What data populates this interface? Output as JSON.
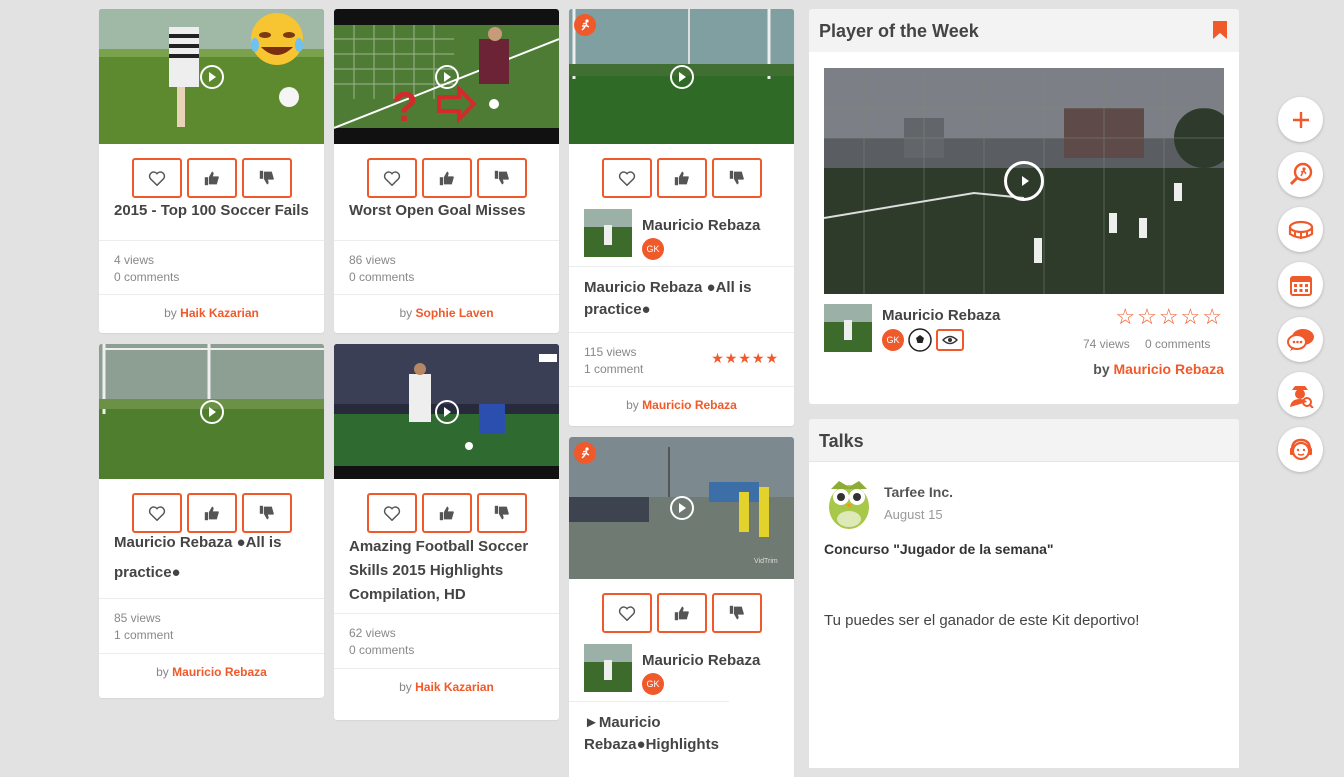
{
  "feed": {
    "col1": [
      {
        "title": "2015 - Top 100 Soccer Fails",
        "views": "4 views",
        "comments": "0 comments",
        "by_prefix": "by",
        "author": "Haik Kazarian"
      },
      {
        "title": "Mauricio Rebaza ●All is practice●",
        "views": "85 views",
        "comments": "1 comment",
        "by_prefix": "by",
        "author": "Mauricio Rebaza"
      }
    ],
    "col2": [
      {
        "title": "Worst Open Goal Misses",
        "views": "86 views",
        "comments": "0 comments",
        "by_prefix": "by",
        "author": "Sophie Laven"
      },
      {
        "title": "Amazing Football Soccer Skills 2015 Highlights Compilation, HD",
        "views": "62 views",
        "comments": "0 comments",
        "by_prefix": "by",
        "author": "Haik Kazarian"
      }
    ],
    "col3": [
      {
        "player": "Mauricio Rebaza",
        "badge": "GK",
        "title": "Mauricio Rebaza ●All is practice●",
        "views": "115 views",
        "comments": "1 comment",
        "stars": "★★★★★",
        "by_prefix": "by",
        "author": "Mauricio Rebaza"
      },
      {
        "player": "Mauricio Rebaza",
        "badge": "GK",
        "title": "►Mauricio Rebaza●Highlights"
      }
    ]
  },
  "potw": {
    "heading": "Player of the Week",
    "player": "Mauricio Rebaza",
    "badge": "GK",
    "stars": "☆☆☆☆☆",
    "views": "74 views",
    "comments": "0 comments",
    "by_prefix": "by",
    "author": "Mauricio Rebaza"
  },
  "talks": {
    "heading": "Talks",
    "company": "Tarfee Inc.",
    "date": "August 15",
    "post_title": "Concurso \"Jugador de la semana\"",
    "post_body": "Tu puedes ser el ganador de este Kit deportivo!"
  },
  "icons": {
    "actions": [
      "heart-icon",
      "thumbs-up-icon",
      "thumbs-down-icon"
    ],
    "sidebar": [
      "plus-icon",
      "search-player-icon",
      "stadium-icon",
      "calendar-icon",
      "chat-icon",
      "scout-icon",
      "support-icon"
    ]
  },
  "colors": {
    "accent": "#f0592a",
    "background": "#e2e2e2",
    "card": "#ffffff"
  }
}
